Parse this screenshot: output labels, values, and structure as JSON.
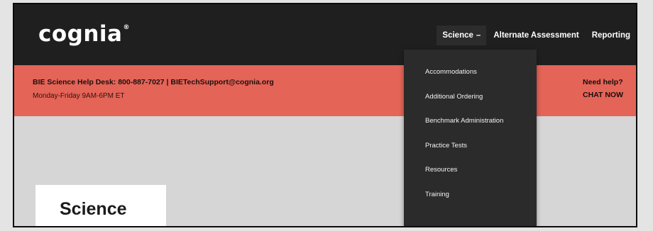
{
  "brand": {
    "logo_text": "cognia",
    "logo_mark": "®"
  },
  "nav": {
    "items": [
      {
        "label": "Science",
        "chevron": "–"
      },
      {
        "label": "Alternate Assessment"
      },
      {
        "label": "Reporting"
      }
    ]
  },
  "dropdown": {
    "items": [
      "Accommodations",
      "Additional Ordering",
      "Benchmark Administration",
      "Practice Tests",
      "Resources",
      "Training"
    ]
  },
  "banner": {
    "help_desk": "BIE Science Help Desk: 800-887-7027 | BIETechSupport@cognia.org",
    "hours": "Monday-Friday 9AM-6PM ET",
    "need_help": "Need help?",
    "chat": "CHAT NOW",
    "color": "#e46457"
  },
  "main": {
    "page_title": "Science"
  }
}
